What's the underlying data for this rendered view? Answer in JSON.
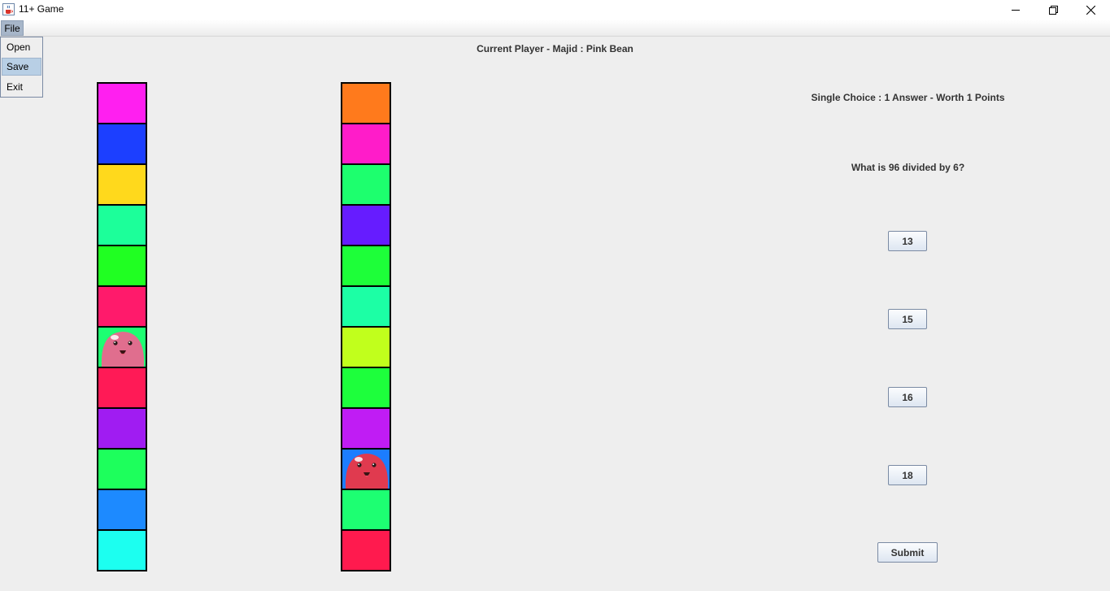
{
  "window": {
    "title": "11+ Game",
    "icon": "java-coffee-cup-icon"
  },
  "menu": {
    "file_label": "File",
    "items": [
      "Open",
      "Save",
      "Exit"
    ],
    "highlighted": "Save"
  },
  "status": {
    "current_player": "Current Player - Majid : Pink Bean"
  },
  "boards": [
    {
      "cells": [
        "#ff1ff0",
        "#1c3fff",
        "#ffd91c",
        "#1cff9a",
        "#20ff22",
        "#ff1a6b",
        "#1dff72",
        "#ff1a56",
        "#a01cf2",
        "#1dff5c",
        "#1d8aff",
        "#1cfff0"
      ],
      "token_cell": 6,
      "token": "pink-bean-avatar-icon",
      "token_color": "#e06e8e"
    },
    {
      "cells": [
        "#ff7a1c",
        "#ff1cc9",
        "#1dff6e",
        "#661cff",
        "#1dff39",
        "#1cffa5",
        "#c1ff1c",
        "#1dff3c",
        "#c01cf4",
        "#1c7dff",
        "#1dff72",
        "#ff1a4e"
      ],
      "token_cell": 9,
      "token": "red-bean-avatar-icon",
      "token_color": "#e03a4f"
    }
  ],
  "question": {
    "type_label": "Single Choice : 1 Answer - Worth 1 Points",
    "text": "What is 96 divided by 6?",
    "answers": [
      "13",
      "15",
      "16",
      "18"
    ],
    "submit_label": "Submit"
  }
}
